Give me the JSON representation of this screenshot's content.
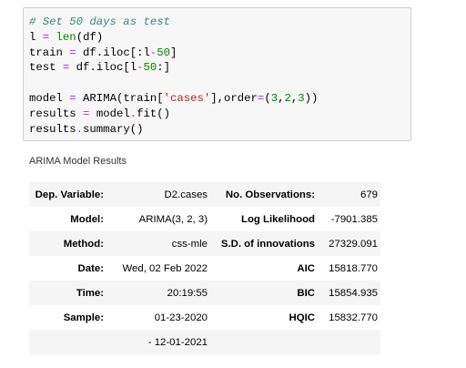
{
  "code_cell": {
    "lines": [
      [
        {
          "t": "# Set 50 days as test",
          "c": "c"
        }
      ],
      [
        {
          "t": "l ",
          "c": "p"
        },
        {
          "t": "=",
          "c": "o"
        },
        {
          "t": " ",
          "c": "p"
        },
        {
          "t": "len",
          "c": "n"
        },
        {
          "t": "(df)",
          "c": "p"
        }
      ],
      [
        {
          "t": "train ",
          "c": "p"
        },
        {
          "t": "=",
          "c": "o"
        },
        {
          "t": " df.iloc[:l",
          "c": "p"
        },
        {
          "t": "-",
          "c": "o"
        },
        {
          "t": "50",
          "c": "mi"
        },
        {
          "t": "]",
          "c": "p"
        }
      ],
      [
        {
          "t": "test ",
          "c": "p"
        },
        {
          "t": "=",
          "c": "o"
        },
        {
          "t": " df.iloc[l",
          "c": "p"
        },
        {
          "t": "-",
          "c": "o"
        },
        {
          "t": "50",
          "c": "mi"
        },
        {
          "t": ":]",
          "c": "p"
        }
      ],
      [],
      [
        {
          "t": "model ",
          "c": "p"
        },
        {
          "t": "=",
          "c": "o"
        },
        {
          "t": " ARIMA(train[",
          "c": "p"
        },
        {
          "t": "'cases'",
          "c": "s"
        },
        {
          "t": "],order",
          "c": "p"
        },
        {
          "t": "=",
          "c": "o"
        },
        {
          "t": "(",
          "c": "p"
        },
        {
          "t": "3",
          "c": "mi"
        },
        {
          "t": ",",
          "c": "p"
        },
        {
          "t": "2",
          "c": "mi"
        },
        {
          "t": ",",
          "c": "p"
        },
        {
          "t": "3",
          "c": "mi"
        },
        {
          "t": "))",
          "c": "p"
        }
      ],
      [
        {
          "t": "results ",
          "c": "p"
        },
        {
          "t": "=",
          "c": "o"
        },
        {
          "t": " model",
          "c": "p"
        },
        {
          "t": ".",
          "c": "o"
        },
        {
          "t": "fit()",
          "c": "p"
        }
      ],
      [
        {
          "t": "results",
          "c": "p"
        },
        {
          "t": ".",
          "c": "o"
        },
        {
          "t": "summary()",
          "c": "p"
        }
      ]
    ]
  },
  "output": {
    "title": "ARIMA Model Results",
    "rows": [
      [
        "Dep. Variable:",
        "D2.cases",
        "No. Observations:",
        "679"
      ],
      [
        "Model:",
        "ARIMA(3, 2, 3)",
        "Log Likelihood",
        "-7901.385"
      ],
      [
        "Method:",
        "css-mle",
        "S.D. of innovations",
        "27329.091"
      ],
      [
        "Date:",
        "Wed, 02 Feb 2022",
        "AIC",
        "15818.770"
      ],
      [
        "Time:",
        "20:19:55",
        "BIC",
        "15854.935"
      ],
      [
        "Sample:",
        "01-23-2020",
        "HQIC",
        "15832.770"
      ],
      [
        "",
        "- 12-01-2021",
        "",
        ""
      ]
    ]
  }
}
